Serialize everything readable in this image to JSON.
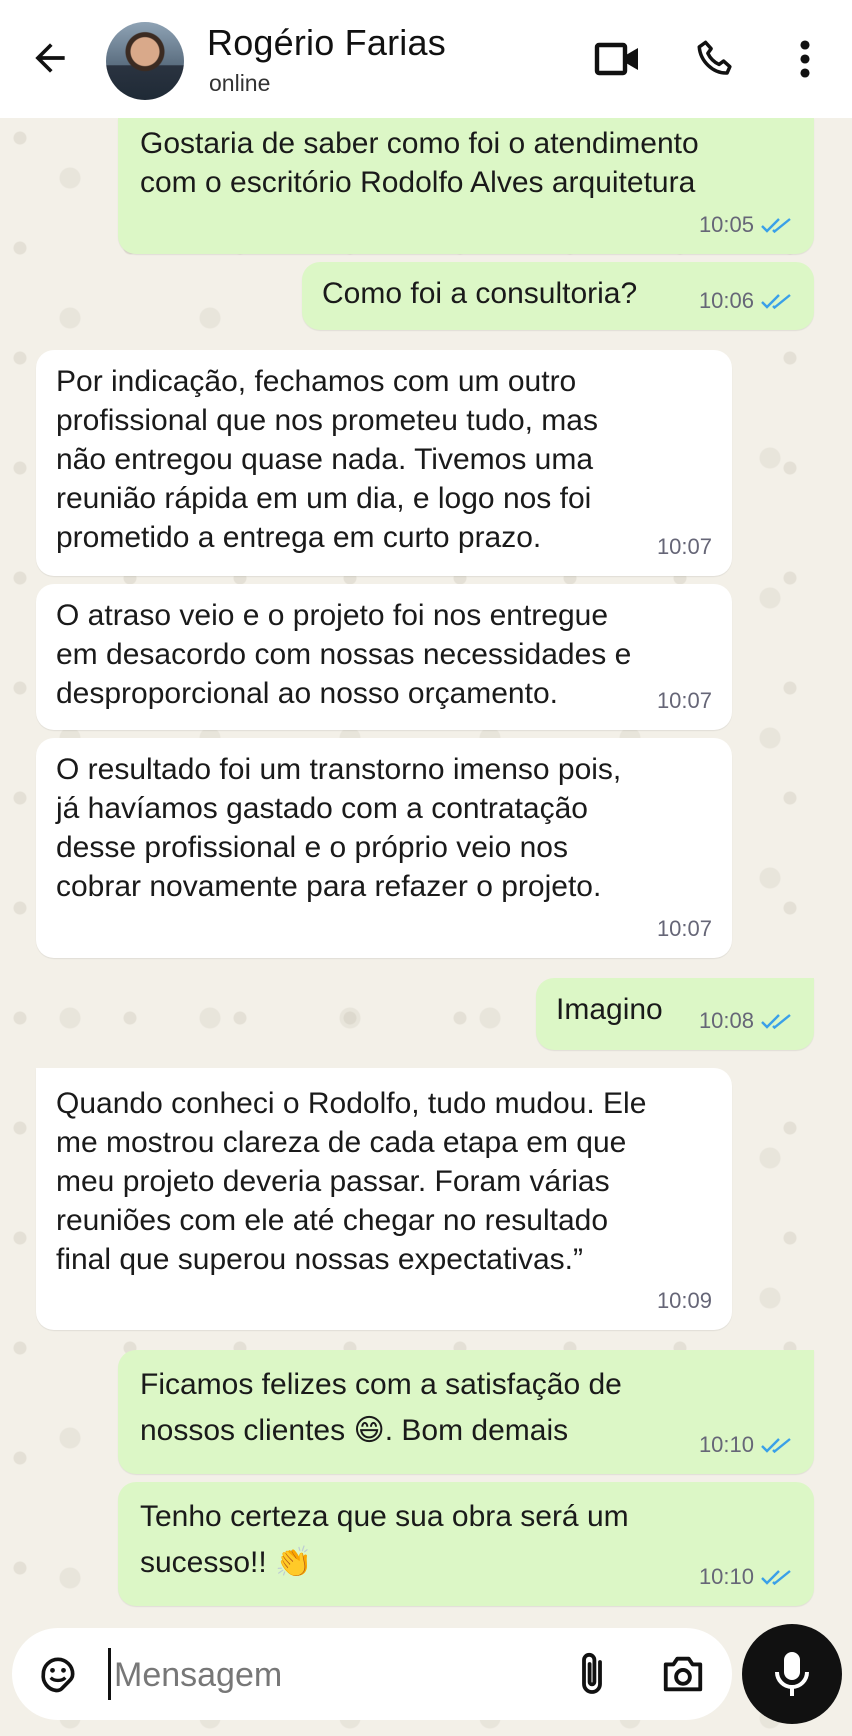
{
  "header": {
    "contact_name": "Rogério Farias",
    "status": "online"
  },
  "icons": {
    "back": "arrow-left-icon",
    "video": "video-camera-icon",
    "call": "phone-icon",
    "more": "more-vertical-icon",
    "sticker": "sticker-icon",
    "attach": "paperclip-icon",
    "camera": "camera-icon",
    "mic": "microphone-icon"
  },
  "colors": {
    "outgoing_bubble": "#dcf7c6",
    "incoming_bubble": "#ffffff",
    "read_ticks": "#3aa0e8",
    "mic_button": "#111111"
  },
  "messages": [
    {
      "direction": "out",
      "text": "Gostaria de saber como foi o atendimento\ncom o escritório Rodolfo Alves arquitetura",
      "time": "10:05",
      "read": true
    },
    {
      "direction": "out",
      "text": "Como foi a consultoria?",
      "time": "10:06",
      "read": true
    },
    {
      "direction": "in",
      "text": "Por indicação, fechamos com um outro\nprofissional que nos prometeu tudo, mas\nnão entregou quase nada. Tivemos uma\nreunião rápida em um dia, e logo nos foi\nprometido a entrega em curto prazo.",
      "time": "10:07"
    },
    {
      "direction": "in",
      "text": "O atraso veio e o projeto foi nos entregue\nem desacordo com nossas necessidades e\ndesproporcional ao nosso orçamento.",
      "time": "10:07"
    },
    {
      "direction": "in",
      "text": "O resultado foi um transtorno imenso pois,\njá havíamos gastado com a contratação\ndesse profissional e o próprio veio nos\ncobrar novamente para refazer o projeto.",
      "time": "10:07"
    },
    {
      "direction": "out",
      "text": "Imagino",
      "time": "10:08",
      "read": true
    },
    {
      "direction": "in",
      "text": "Quando conheci o Rodolfo, tudo mudou. Ele\nme mostrou clareza de cada etapa em que\nmeu projeto deveria passar. Foram várias\nreuniões com ele até chegar no resultado\nfinal que superou nossas expectativas.”",
      "time": "10:09"
    },
    {
      "direction": "out",
      "text_a": "Ficamos felizes com a satisfação de\nnossos clientes ",
      "emoji": "😄",
      "text_b": ". Bom demais",
      "time": "10:10",
      "read": true
    },
    {
      "direction": "out",
      "text_a": "Tenho certeza que sua obra será um\nsucesso!! ",
      "emoji": "👏",
      "time": "10:10",
      "read": true
    }
  ],
  "composer": {
    "placeholder": "Mensagem"
  }
}
